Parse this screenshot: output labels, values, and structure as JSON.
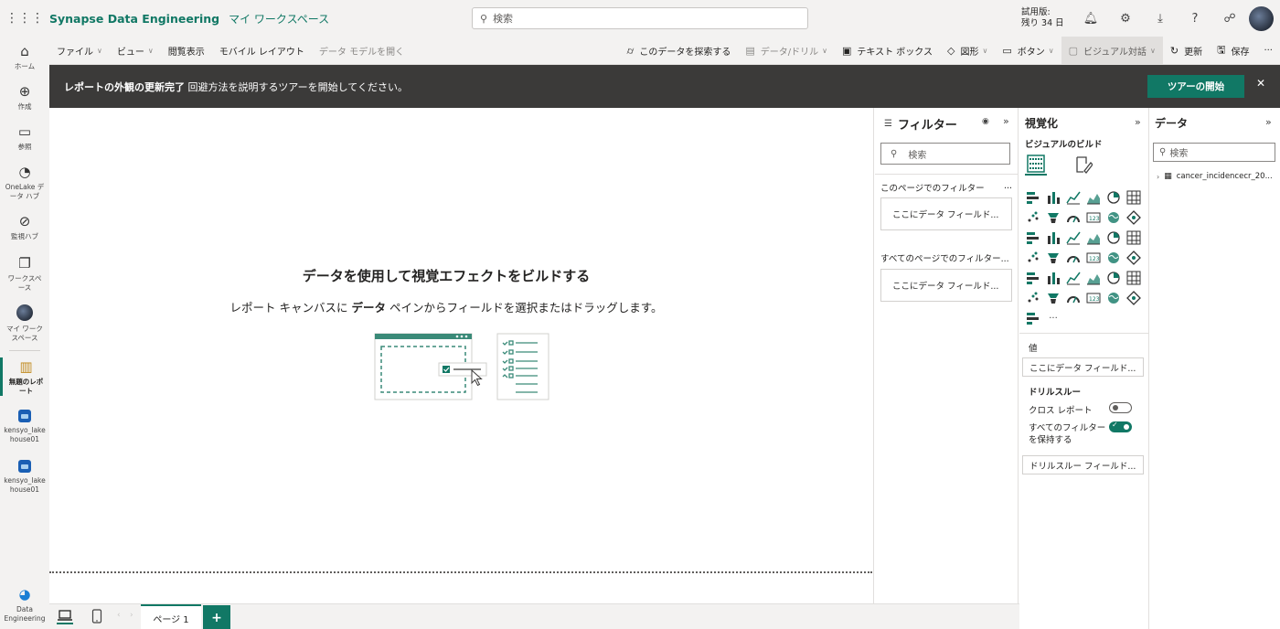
{
  "header": {
    "app_title": "Synapse Data Engineering",
    "workspace": "マイ ワークスペース",
    "search_placeholder": "検索",
    "trial_line1": "試用版:",
    "trial_line2": "残り 34 日"
  },
  "nav": {
    "home": "ホーム",
    "create": "作成",
    "browse": "参照",
    "onelake_1": "OneLake デ",
    "onelake_2": "ータ ハブ",
    "monitor": "監視ハブ",
    "workspaces_1": "ワークスペ",
    "workspaces_2": "ース",
    "myws_1": "マイ ワーク",
    "myws_2": "スペース",
    "untitled_1": "無題のレポ",
    "untitled_2": "ート",
    "lakehouse1_1": "kensyo_lake",
    "lakehouse1_2": "house01",
    "lakehouse2_1": "kensyo_lake",
    "lakehouse2_2": "house01",
    "data_eng_1": "Data",
    "data_eng_2": "Engineering"
  },
  "ribbon": {
    "file": "ファイル",
    "view": "ビュー",
    "reading_view": "閲覧表示",
    "mobile_layout": "モバイル レイアウト",
    "open_data_model": "データ モデルを開く",
    "explore": "このデータを探索する",
    "data_drill": "データ/ドリル",
    "text_box": "テキスト ボックス",
    "shapes": "図形",
    "buttons": "ボタン",
    "visual_chat": "ビジュアル対話",
    "refresh": "更新",
    "save": "保存",
    "more": "···"
  },
  "banner": {
    "bold": "レポートの外観の更新完了",
    "text": " 回避方法を説明するツアーを開始してください。",
    "tour_button": "ツアーの開始"
  },
  "canvas": {
    "title": "データを使用して視覚エフェクトをビルドする",
    "sub_before": "レポート キャンバスに ",
    "sub_bold": "データ",
    "sub_after": " ペインからフィールドを選択またはドラッグします。"
  },
  "filters": {
    "title": "フィルター",
    "search": "検索",
    "page_section": "このページでのフィルター",
    "page_more": "...",
    "page_well": "ここにデータ フィールド...",
    "all_section": "すべてのページでのフィルター...",
    "all_well": "ここにデータ フィールド..."
  },
  "viz": {
    "title": "視覚化",
    "build": "ビジュアルのビルド",
    "more": "···",
    "values_label": "値",
    "values_well": "ここにデータ フィールド...",
    "drill_label": "ドリルスルー",
    "cross_report": "クロス レポート",
    "cross_report_on": false,
    "keep_filters_1": "すべてのフィルター",
    "keep_filters_2": "を保持する",
    "keep_filters_on": true,
    "drill_well": "ドリルスルー フィールド...",
    "icons": [
      "stacked-bar-icon",
      "stacked-column-icon",
      "clustered-bar-icon",
      "clustered-column-icon",
      "100-bar-icon",
      "100-column-icon",
      "line-chart-icon",
      "area-chart-icon",
      "stacked-area-icon",
      "line-column-icon",
      "line-clustered-icon",
      "ribbon-chart-icon",
      "waterfall-icon",
      "funnel-icon",
      "scatter-icon",
      "pie-chart-icon",
      "donut-chart-icon",
      "treemap-icon",
      "map-icon",
      "filled-map-icon",
      "azure-map-icon",
      "gauge-icon",
      "card-icon",
      "multi-row-card-icon",
      "kpi-icon",
      "slicer-icon",
      "table-icon",
      "matrix-icon",
      "decomposition-tree-icon",
      "key-influencers-icon",
      "qa-icon",
      "narrative-icon",
      "trophy-icon",
      "paginated-report-icon",
      "arcgis-icon",
      "power-apps-icon",
      "power-automate-icon"
    ]
  },
  "data": {
    "title": "データ",
    "search": "検索",
    "table_name": "cancer_incidencecr_20..."
  },
  "bottom": {
    "page_tab": "ページ 1",
    "add": "+"
  },
  "colors": {
    "accent": "#117865",
    "banner_bg": "#3b3a39"
  }
}
